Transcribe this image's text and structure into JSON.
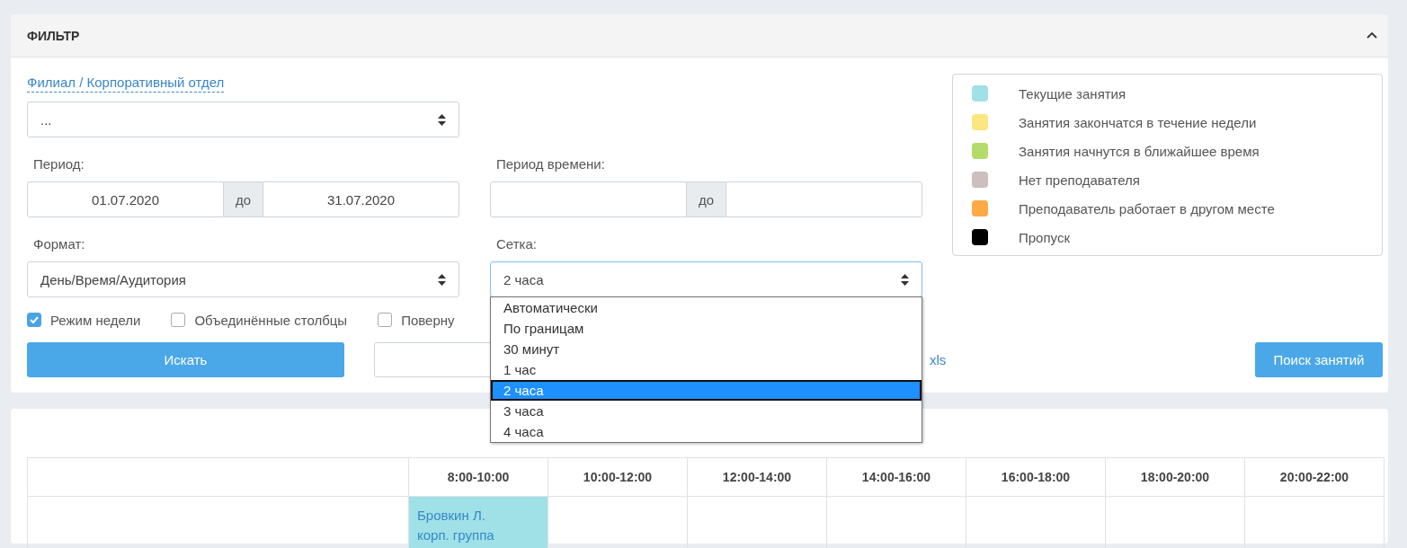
{
  "filter": {
    "title": "ФИЛЬТР",
    "expanded": true,
    "branch_link": "Филиал / Корпоративный отдел",
    "branch_select": {
      "value": "..."
    },
    "period": {
      "label": "Период:",
      "from": "01.07.2020",
      "separator": "до",
      "to": "31.07.2020"
    },
    "time_period": {
      "label": "Период времени:",
      "separator": "до"
    },
    "format": {
      "label": "Формат:",
      "value": "День/Время/Аудитория"
    },
    "grid": {
      "label": "Сетка:",
      "value": "2 часа",
      "options": [
        {
          "label": "Автоматически",
          "selected": false
        },
        {
          "label": "По границам",
          "selected": false
        },
        {
          "label": "30 минут",
          "selected": false
        },
        {
          "label": "1 час",
          "selected": false
        },
        {
          "label": "2 часа",
          "selected": true
        },
        {
          "label": "3 часа",
          "selected": false
        },
        {
          "label": "4 часа",
          "selected": false
        }
      ]
    },
    "checkboxes": [
      {
        "label": "Режим недели",
        "checked": true
      },
      {
        "label": "Объединённые столбцы",
        "checked": false
      },
      {
        "label": "Поверну",
        "checked": false
      }
    ],
    "search_button": "Искать",
    "export_link": "xls",
    "find_lessons_button": "Поиск занятий"
  },
  "legend": [
    {
      "label": "Текущие занятия",
      "color": "#9fe1e7"
    },
    {
      "label": "Занятия закончатся в течение недели",
      "color": "#fbe681"
    },
    {
      "label": "Занятия начнутся в ближайшее время",
      "color": "#b4dc6b"
    },
    {
      "label": "Нет преподавателя",
      "color": "#cbbfc0"
    },
    {
      "label": "Преподаватель работает в другом месте",
      "color": "#ffa947"
    },
    {
      "label": "Пропуск",
      "color": "#000000"
    }
  ],
  "schedule": {
    "columns": [
      "8:00-10:00",
      "10:00-12:00",
      "12:00-14:00",
      "14:00-16:00",
      "16:00-18:00",
      "18:00-20:00",
      "20:00-22:00"
    ],
    "rows": [
      {
        "cells": [
          {
            "kind": "lesson",
            "teacher": "Бровкин Л.",
            "group": "корп. группа",
            "color": "#9fe1e7"
          },
          {
            "kind": "empty"
          },
          {
            "kind": "empty"
          },
          {
            "kind": "empty"
          },
          {
            "kind": "empty"
          },
          {
            "kind": "empty"
          },
          {
            "kind": "empty"
          }
        ]
      }
    ]
  }
}
